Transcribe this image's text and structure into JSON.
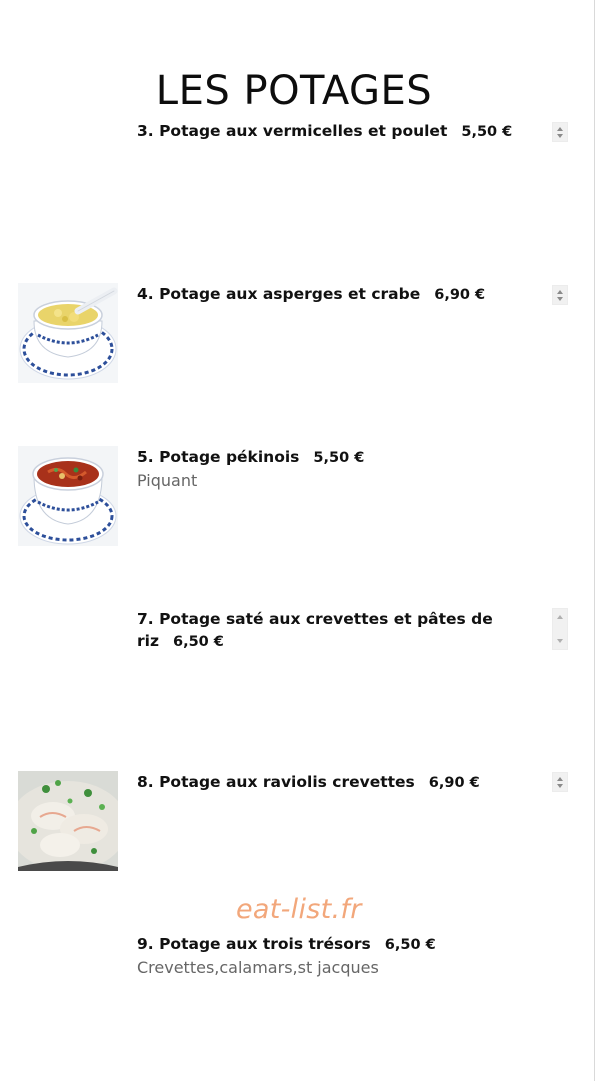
{
  "page": {
    "title": "LES POTAGES"
  },
  "items": [
    {
      "name": "3. Potage aux vermicelles et poulet",
      "price": "5,50 €",
      "description": "",
      "image": ""
    },
    {
      "name": "4. Potage aux asperges et crabe",
      "price": "6,90 €",
      "description": "",
      "image": "corn-crab-soup-bowl-photo"
    },
    {
      "name": "5. Potage pékinois",
      "price": "5,50 €",
      "description": "Piquant",
      "image": "spicy-soup-bowl-photo"
    },
    {
      "name": "7. Potage saté aux crevettes et pâtes de riz",
      "price": "6,50 €",
      "description": "",
      "image": ""
    },
    {
      "name": "8. Potage aux raviolis crevettes",
      "price": "6,90 €",
      "description": "",
      "image": "wonton-soup-photo"
    },
    {
      "name": "9. Potage aux trois trésors",
      "price": "6,50 €",
      "description": "Crevettes,calamars,st jacques",
      "image": ""
    }
  ],
  "watermark": "eat-list.fr",
  "icons": {
    "stepper": "quantity-stepper-arrows"
  }
}
